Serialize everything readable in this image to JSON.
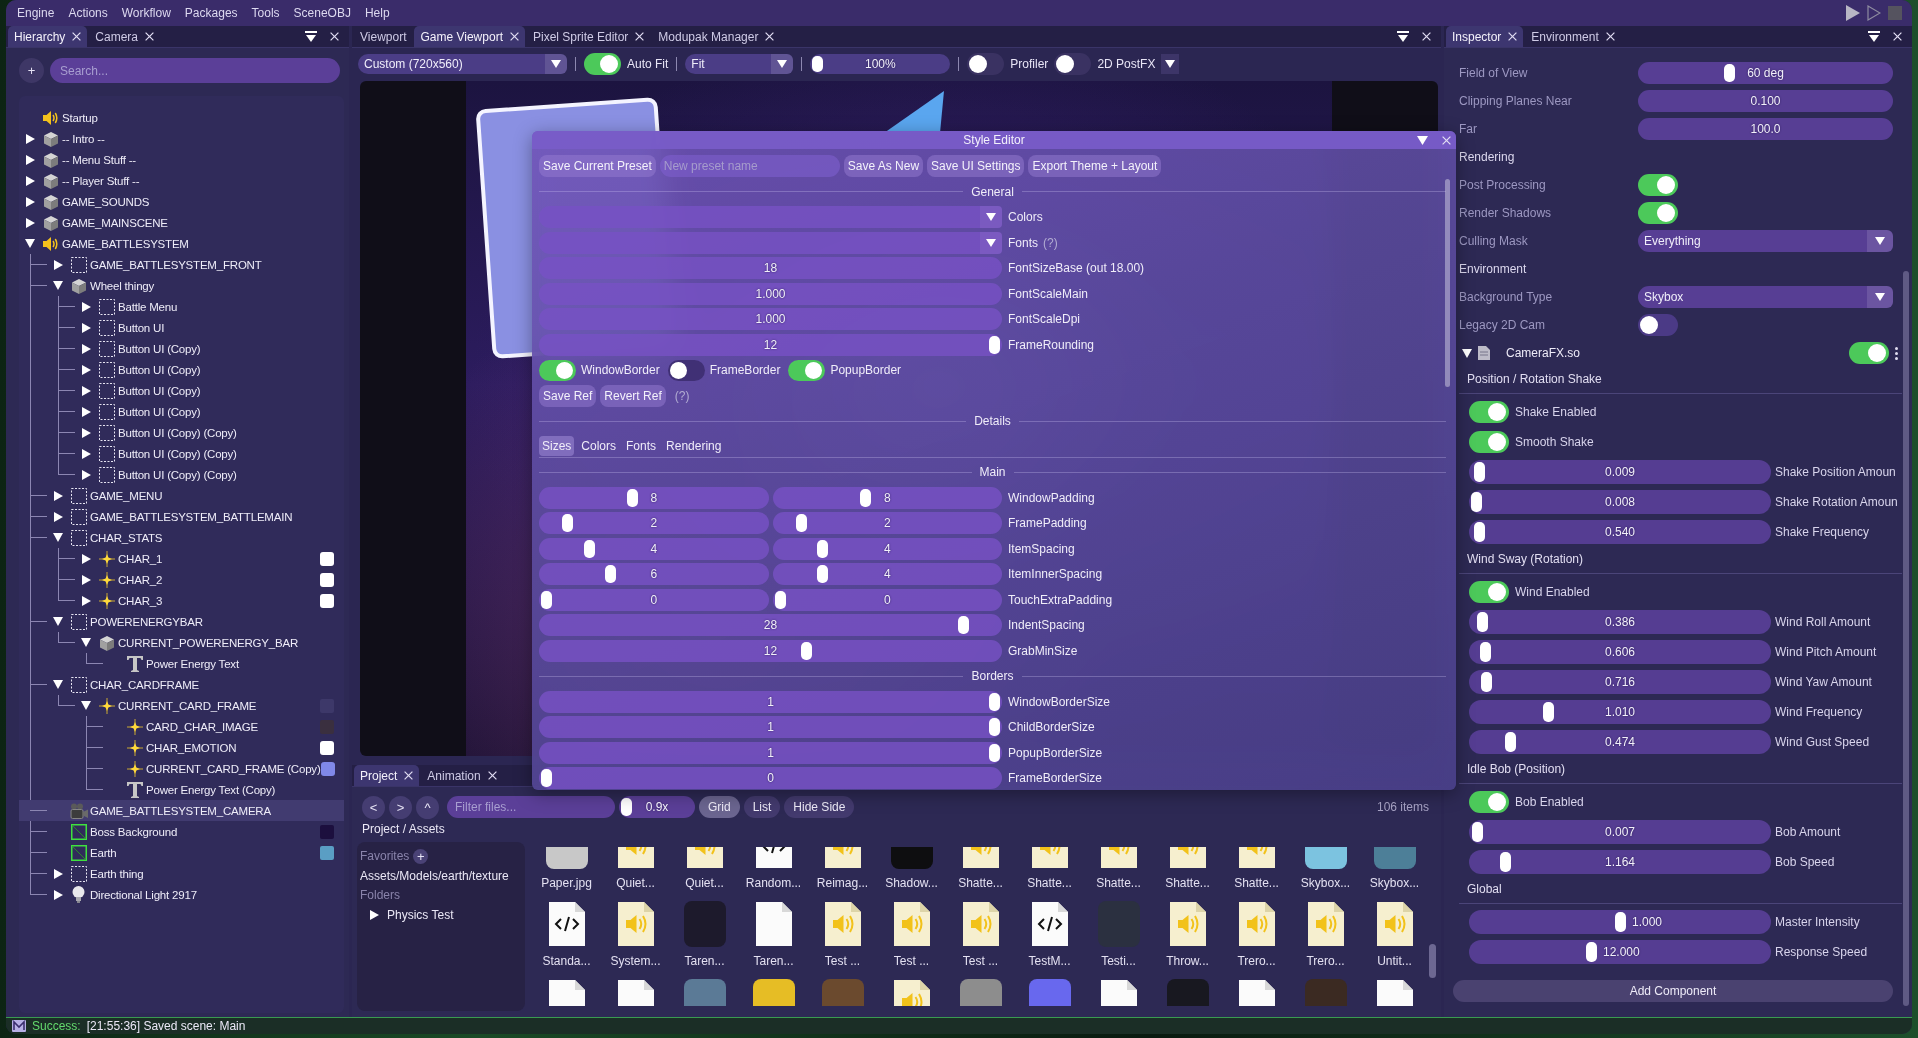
{
  "menu_bar": {
    "items": [
      "Engine",
      "Actions",
      "Workflow",
      "Packages",
      "Tools",
      "SceneOBJ",
      "Help"
    ]
  },
  "hierarchy": {
    "tabs": [
      {
        "label": "Hierarchy",
        "selected": true,
        "closable": true
      },
      {
        "label": "Camera",
        "selected": false,
        "closable": true
      }
    ],
    "add_button": "+",
    "search": {
      "placeholder": "Search..."
    },
    "tree": [
      {
        "name": "Startup",
        "kind": "speaker",
        "selected": false
      },
      {
        "name": "-- Intro --",
        "kind": "cube",
        "expanded": false,
        "selected": false
      },
      {
        "name": "-- Menu Stuff --",
        "kind": "cube",
        "expanded": false,
        "selected": false
      },
      {
        "name": "-- Player Stuff --",
        "kind": "cube",
        "expanded": false,
        "selected": false
      },
      {
        "name": "GAME_SOUNDS",
        "kind": "cube",
        "expanded": false,
        "selected": false
      },
      {
        "name": "GAME_MAINSCENE",
        "kind": "cube",
        "expanded": false,
        "selected": false
      },
      {
        "name": "GAME_BATTLESYSTEM",
        "kind": "speaker",
        "expanded": true,
        "selected": false,
        "children": [
          {
            "name": "GAME_BATTLESYSTEM_FRONT",
            "kind": "empty",
            "expanded": false,
            "selected": false
          },
          {
            "name": "Wheel thingy",
            "kind": "cube",
            "expanded": true,
            "selected": false,
            "children": [
              {
                "name": "Battle Menu",
                "kind": "empty",
                "expanded": false,
                "selected": false
              },
              {
                "name": "Button UI",
                "kind": "empty",
                "expanded": false,
                "selected": false
              },
              {
                "name": "Button UI (Copy)",
                "kind": "empty",
                "expanded": false,
                "selected": false
              },
              {
                "name": "Button UI (Copy)",
                "kind": "empty",
                "expanded": false,
                "selected": false
              },
              {
                "name": "Button UI (Copy)",
                "kind": "empty",
                "expanded": false,
                "selected": false
              },
              {
                "name": "Button UI (Copy)",
                "kind": "empty",
                "expanded": false,
                "selected": false
              },
              {
                "name": "Button UI (Copy) (Copy)",
                "kind": "empty",
                "expanded": false,
                "selected": false
              },
              {
                "name": "Button UI (Copy) (Copy)",
                "kind": "empty",
                "expanded": false,
                "selected": false
              },
              {
                "name": "Button UI (Copy) (Copy)",
                "kind": "empty",
                "expanded": false,
                "selected": false
              }
            ]
          },
          {
            "name": "GAME_MENU",
            "kind": "empty",
            "expanded": false,
            "selected": false
          },
          {
            "name": "GAME_BATTLESYSTEM_BATTLEMAIN",
            "kind": "empty",
            "expanded": false,
            "selected": false
          },
          {
            "name": "CHAR_STATS",
            "kind": "empty",
            "expanded": true,
            "selected": false,
            "children": [
              {
                "name": "CHAR_1",
                "kind": "sparkle",
                "expanded": false,
                "selected": false,
                "thumb": {
                  "kind": "swatch",
                  "color": "#ffffff"
                }
              },
              {
                "name": "CHAR_2",
                "kind": "sparkle",
                "expanded": false,
                "selected": false,
                "thumb": {
                  "kind": "swatch",
                  "color": "#ffffff"
                }
              },
              {
                "name": "CHAR_3",
                "kind": "sparkle",
                "expanded": false,
                "selected": false,
                "thumb": {
                  "kind": "swatch",
                  "color": "#ffffff"
                }
              }
            ]
          },
          {
            "name": "POWERENERGYBAR",
            "kind": "empty",
            "expanded": true,
            "selected": false,
            "children": [
              {
                "name": "CURRENT_POWERENERGY_BAR",
                "kind": "cube",
                "expanded": true,
                "selected": false,
                "children": [
                  {
                    "name": "Power Energy Text",
                    "kind": "text",
                    "selected": false
                  }
                ]
              }
            ]
          },
          {
            "name": "CHAR_CARDFRAME",
            "kind": "empty",
            "expanded": true,
            "selected": false,
            "children": [
              {
                "name": "CURRENT_CARD_FRAME",
                "kind": "sparkle",
                "expanded": true,
                "selected": false,
                "thumb": {
                  "kind": "image",
                  "color": "#3d3869"
                },
                "children": [
                  {
                    "name": "CARD_CHAR_IMAGE",
                    "kind": "sparkle",
                    "selected": false,
                    "thumb": {
                      "kind": "image",
                      "color": "#3a2f3f"
                    }
                  },
                  {
                    "name": "CHAR_EMOTION",
                    "kind": "sparkle",
                    "selected": false,
                    "thumb": {
                      "kind": "swatch",
                      "color": "#ffffff"
                    }
                  },
                  {
                    "name": "CURRENT_CARD_FRAME (Copy)",
                    "kind": "sparkle",
                    "selected": false,
                    "thumb": {
                      "kind": "swatch",
                      "color": "#8088e8"
                    }
                  },
                  {
                    "name": "Power Energy Text (Copy)",
                    "kind": "text",
                    "selected": false
                  }
                ]
              }
            ]
          },
          {
            "name": "GAME_BATTLESYSTEM_CAMERA",
            "kind": "camera",
            "selected": true
          },
          {
            "name": "Boss Background",
            "kind": "sprite",
            "selected": false,
            "thumb": {
              "kind": "image",
              "color": "#1c0f3e"
            }
          },
          {
            "name": "Earth",
            "kind": "sprite",
            "selected": false,
            "thumb": {
              "kind": "image",
              "color": "#5a9ec4"
            }
          },
          {
            "name": "Earth thing",
            "kind": "empty",
            "expanded": false,
            "selected": false
          },
          {
            "name": "Directional Light 2917",
            "kind": "bulb",
            "expanded": false,
            "selected": false
          }
        ]
      }
    ]
  },
  "center": {
    "tabs": [
      {
        "label": "Viewport",
        "selected": false,
        "closable": false
      },
      {
        "label": "Game Viewport",
        "selected": true,
        "closable": true
      },
      {
        "label": "Pixel Sprite Editor",
        "selected": false,
        "closable": true
      },
      {
        "label": "Modupak Manager",
        "selected": false,
        "closable": true
      }
    ],
    "toolbar": {
      "resolution": "Custom (720x560)",
      "auto_fit": {
        "label": "Auto Fit",
        "on": true
      },
      "fit_mode": "Fit",
      "zoom": {
        "value": "100%",
        "level": 0
      },
      "toggles": [
        {
          "label": "Profiler",
          "on": false
        },
        {
          "label": "2D PostFX",
          "on": false
        }
      ]
    }
  },
  "style_editor": {
    "title": "Style Editor",
    "preset": {
      "save_button": "Save Current Preset",
      "name_field": {
        "placeholder": "New preset name"
      },
      "buttons": [
        "Save As New",
        "Save UI Settings",
        "Export Theme + Layout"
      ]
    },
    "rows": [
      {
        "kind": "header",
        "label": "General"
      },
      {
        "kind": "combo",
        "label": "Colors"
      },
      {
        "kind": "combo",
        "label": "Fonts",
        "help": "(?)"
      },
      {
        "kind": "drag",
        "label": "FontSizeBase (out 18.00)",
        "value": "18"
      },
      {
        "kind": "drag",
        "label": "FontScaleMain",
        "value": "1.000"
      },
      {
        "kind": "drag",
        "label": "FontScaleDpi",
        "value": "1.000"
      },
      {
        "kind": "slider",
        "label": "FrameRounding",
        "value": "12",
        "level": 1
      },
      {
        "kind": "toggles",
        "items": [
          {
            "label": "WindowBorder",
            "on": true
          },
          {
            "label": "FrameBorder",
            "on": false
          },
          {
            "label": "PopupBorder",
            "on": true
          }
        ]
      },
      {
        "kind": "buttons",
        "items": [
          "Save Ref",
          "Revert Ref"
        ],
        "help": "(?)"
      },
      {
        "kind": "header",
        "label": "Details"
      },
      {
        "kind": "tabs",
        "items": [
          {
            "label": "Sizes",
            "selected": true
          },
          {
            "label": "Colors",
            "selected": false
          },
          {
            "label": "Fonts",
            "selected": false
          },
          {
            "label": "Rendering",
            "selected": false
          }
        ]
      },
      {
        "kind": "header",
        "label": "Main"
      },
      {
        "kind": "slider2",
        "label": "WindowPadding",
        "values": [
          {
            "value": "8",
            "level": 0.4
          },
          {
            "value": "8",
            "level": 0.4
          }
        ]
      },
      {
        "kind": "slider2",
        "label": "FramePadding",
        "values": [
          {
            "value": "2",
            "level": 0.1
          },
          {
            "value": "2",
            "level": 0.1
          }
        ]
      },
      {
        "kind": "slider2",
        "label": "ItemSpacing",
        "values": [
          {
            "value": "4",
            "level": 0.2
          },
          {
            "value": "4",
            "level": 0.2
          }
        ]
      },
      {
        "kind": "slider2",
        "label": "ItemInnerSpacing",
        "values": [
          {
            "value": "6",
            "level": 0.3
          },
          {
            "value": "4",
            "level": 0.2
          }
        ]
      },
      {
        "kind": "slider2",
        "label": "TouchExtraPadding",
        "values": [
          {
            "value": "0",
            "level": 0
          },
          {
            "value": "0",
            "level": 0
          }
        ]
      },
      {
        "kind": "slider",
        "label": "IndentSpacing",
        "value": "28",
        "level": 0.93
      },
      {
        "kind": "slider",
        "label": "GrabMinSize",
        "value": "12",
        "level": 0.58
      },
      {
        "kind": "header",
        "label": "Borders"
      },
      {
        "kind": "slider",
        "label": "WindowBorderSize",
        "value": "1",
        "level": 1
      },
      {
        "kind": "slider",
        "label": "ChildBorderSize",
        "value": "1",
        "level": 1
      },
      {
        "kind": "slider",
        "label": "PopupBorderSize",
        "value": "1",
        "level": 1
      },
      {
        "kind": "slider",
        "label": "FrameBorderSize",
        "value": "0",
        "level": 0
      }
    ]
  },
  "project": {
    "tabs": [
      {
        "label": "Project",
        "selected": true,
        "closable": true
      },
      {
        "label": "Animation",
        "selected": false,
        "closable": true
      }
    ],
    "nav": [
      "<",
      ">",
      "^"
    ],
    "filter": {
      "placeholder": "Filter files..."
    },
    "thumb_size": {
      "value": "0.9x",
      "level": 0
    },
    "views": [
      {
        "label": "Grid",
        "selected": true
      },
      {
        "label": "List",
        "selected": false
      }
    ],
    "hide_side": "Hide Side",
    "count": "106 items",
    "breadcrumb": "Project / Assets",
    "sidebar": {
      "favorites": "Favorites",
      "add": "+",
      "favorite_items": [
        "Assets/Models/earth/texture"
      ],
      "folders": "Folders",
      "folder_items": [
        {
          "name": "Physics Test",
          "expanded": false
        }
      ]
    },
    "asset_rows": [
      [
        {
          "kind": "image",
          "label": "Paper.jpg",
          "color": "#c8c8c8"
        },
        {
          "kind": "audio",
          "label": "Quiet..."
        },
        {
          "kind": "audio",
          "label": "Quiet..."
        },
        {
          "kind": "code",
          "label": "Random..."
        },
        {
          "kind": "audio",
          "label": "Reimag..."
        },
        {
          "kind": "image",
          "label": "Shadow...",
          "color": "#0e0e10"
        },
        {
          "kind": "audio",
          "label": "Shatte..."
        },
        {
          "kind": "audio",
          "label": "Shatte..."
        },
        {
          "kind": "audio",
          "label": "Shatte..."
        },
        {
          "kind": "audio",
          "label": "Shatte..."
        },
        {
          "kind": "audio",
          "label": "Shatte..."
        },
        {
          "kind": "image",
          "label": "Skybox...",
          "color": "#7cc3e0"
        },
        {
          "kind": "image",
          "label": "Skybox...",
          "color": "#4d7f98"
        }
      ],
      [
        {
          "kind": "code",
          "label": "Standa..."
        },
        {
          "kind": "audio",
          "label": "System..."
        },
        {
          "kind": "image",
          "label": "Taren...",
          "color": "#1d1a2c"
        },
        {
          "kind": "file",
          "label": "Taren..."
        },
        {
          "kind": "audio",
          "label": "Test ..."
        },
        {
          "kind": "audio",
          "label": "Test ..."
        },
        {
          "kind": "audio",
          "label": "Test ..."
        },
        {
          "kind": "code",
          "label": "TestM..."
        },
        {
          "kind": "image",
          "label": "Testi...",
          "color": "#2b3040"
        },
        {
          "kind": "audio",
          "label": "Throw..."
        },
        {
          "kind": "audio",
          "label": "Trero..."
        },
        {
          "kind": "audio",
          "label": "Trero..."
        },
        {
          "kind": "audio",
          "label": "Untit..."
        }
      ],
      [
        {
          "kind": "file"
        },
        {
          "kind": "file"
        },
        {
          "kind": "image",
          "color": "#5b7a96"
        },
        {
          "kind": "image",
          "color": "#e6bd25"
        },
        {
          "kind": "image",
          "color": "#6b4a2e"
        },
        {
          "kind": "audio"
        },
        {
          "kind": "image",
          "color": "#8d8d8d"
        },
        {
          "kind": "image",
          "color": "#6868ee"
        },
        {
          "kind": "file"
        },
        {
          "kind": "image",
          "color": "#181820"
        },
        {
          "kind": "file"
        },
        {
          "kind": "image",
          "color": "#3b2a22"
        },
        {
          "kind": "file"
        }
      ]
    ]
  },
  "inspector": {
    "tabs": [
      {
        "label": "Inspector",
        "selected": true,
        "closable": true
      },
      {
        "label": "Environment",
        "selected": false,
        "closable": true
      }
    ],
    "rows": [
      {
        "kind": "slider",
        "label": "Field of View",
        "value": "60 deg",
        "level": 0.35
      },
      {
        "kind": "field",
        "label": "Clipping Planes Near",
        "value": "0.100"
      },
      {
        "kind": "field",
        "label": "Far",
        "value": "100.0"
      },
      {
        "kind": "heading",
        "label": "Rendering"
      },
      {
        "kind": "toggle",
        "label": "Post Processing",
        "on": true
      },
      {
        "kind": "toggle",
        "label": "Render Shadows",
        "on": true
      },
      {
        "kind": "dropdown",
        "label": "Culling Mask",
        "value": "Everything"
      },
      {
        "kind": "heading",
        "label": "Environment"
      },
      {
        "kind": "dropdown",
        "label": "Background Type",
        "value": "Skybox"
      },
      {
        "kind": "toggle",
        "label": "Legacy 2D Cam",
        "on": false
      }
    ],
    "component": {
      "name": "CameraFX.so",
      "expanded": true,
      "enabled": true,
      "groups": [
        {
          "title": "Position / Rotation Shake",
          "rows": [
            {
              "kind": "toggle",
              "label": "Shake Enabled",
              "on": true
            },
            {
              "kind": "toggle",
              "label": "Smooth Shake",
              "on": true
            },
            {
              "kind": "slider",
              "label": "Shake Position Amoun",
              "value": "0.009",
              "level": 0.01
            },
            {
              "kind": "slider",
              "label": "Shake Rotation Amoun",
              "value": "0.008",
              "level": 0
            },
            {
              "kind": "slider",
              "label": "Shake Frequency",
              "value": "0.540",
              "level": 0.01
            }
          ]
        },
        {
          "title": "Wind Sway (Rotation)",
          "rows": [
            {
              "kind": "toggle",
              "label": "Wind Enabled",
              "on": true
            },
            {
              "kind": "slider",
              "label": "Wind Roll Amount",
              "value": "0.386",
              "level": 0.02
            },
            {
              "kind": "slider",
              "label": "Wind Pitch Amount",
              "value": "0.606",
              "level": 0.03
            },
            {
              "kind": "slider",
              "label": "Wind Yaw Amount",
              "value": "0.716",
              "level": 0.035
            },
            {
              "kind": "slider",
              "label": "Wind Frequency",
              "value": "1.010",
              "level": 0.25
            },
            {
              "kind": "slider",
              "label": "Wind Gust Speed",
              "value": "0.474",
              "level": 0.12
            }
          ]
        },
        {
          "title": "Idle Bob (Position)",
          "rows": [
            {
              "kind": "toggle",
              "label": "Bob Enabled",
              "on": true
            },
            {
              "kind": "slider",
              "label": "Bob Amount",
              "value": "0.007",
              "level": 0.005
            },
            {
              "kind": "slider",
              "label": "Bob Speed",
              "value": "1.164",
              "level": 0.1
            }
          ]
        },
        {
          "title": "Global",
          "rows": [
            {
              "kind": "slider",
              "label": "Master Intensity",
              "value": "1.000",
              "level": 0.5
            },
            {
              "kind": "slider",
              "label": "Response Speed",
              "value": "12.000",
              "level": 0.4
            }
          ]
        }
      ]
    },
    "add_component": "Add Component"
  },
  "status_bar": {
    "kind": "success",
    "label": "Success:",
    "message": "[21:55:36] Saved scene: Main"
  }
}
